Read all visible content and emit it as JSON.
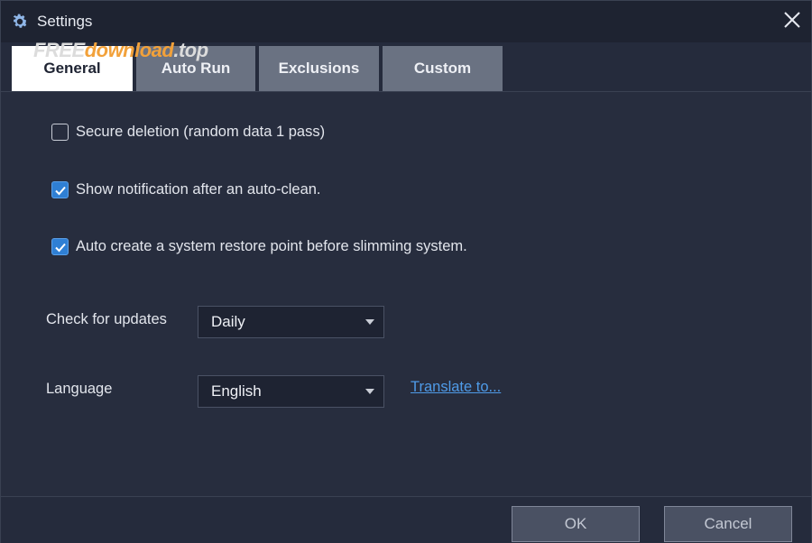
{
  "window": {
    "title": "Settings",
    "icon": "gear-icon",
    "close_icon": "close-icon"
  },
  "watermark": {
    "free": "FREE",
    "download": "download",
    "top": ".top"
  },
  "tabs": [
    {
      "label": "General",
      "active": true
    },
    {
      "label": "Auto Run",
      "active": false
    },
    {
      "label": "Exclusions",
      "active": false
    },
    {
      "label": "Custom",
      "active": false
    }
  ],
  "options": [
    {
      "label": "Secure deletion (random data 1 pass)",
      "checked": false
    },
    {
      "label": "Show notification after an auto-clean.",
      "checked": true
    },
    {
      "label": "Auto create a system restore point before slimming system.",
      "checked": true
    }
  ],
  "updates": {
    "label": "Check for updates",
    "value": "Daily"
  },
  "language": {
    "label": "Language",
    "value": "English",
    "link": "Translate to..."
  },
  "footer": {
    "ok_label": "OK",
    "cancel_label": "Cancel"
  },
  "colors": {
    "background": "#252b3c",
    "accent": "#2f7fd4",
    "link": "#4f9be8",
    "tab_inactive": "#6a7282",
    "tab_active": "#ffffff"
  }
}
